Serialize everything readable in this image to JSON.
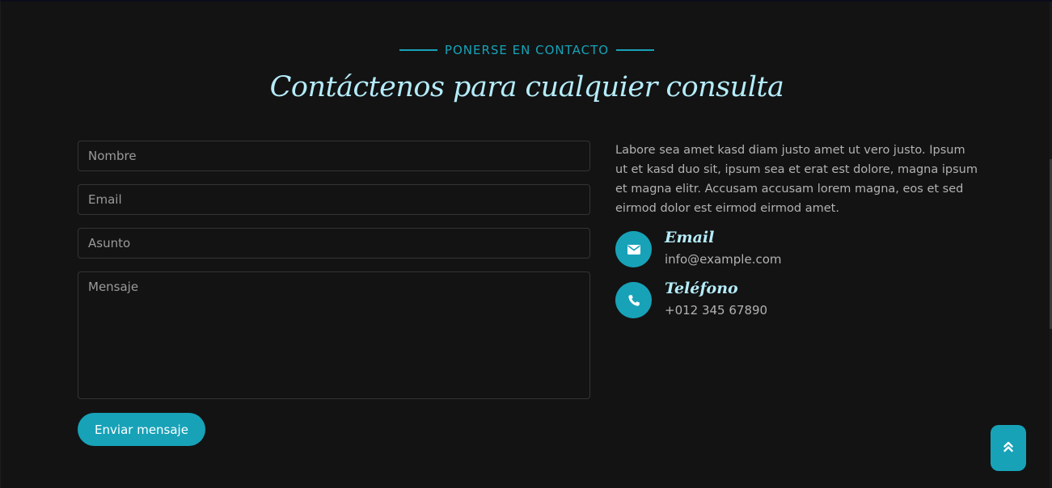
{
  "section": {
    "eyebrow": "PONERSE EN CONTACTO",
    "heading": "Contáctenos para cualquier consulta"
  },
  "form": {
    "name_placeholder": "Nombre",
    "email_placeholder": "Email",
    "subject_placeholder": "Asunto",
    "message_placeholder": "Mensaje",
    "submit_label": "Enviar mensaje"
  },
  "info": {
    "description": "Labore sea amet kasd diam justo amet ut vero justo. Ipsum ut et kasd duo sit, ipsum sea et erat est dolore, magna ipsum et magna elitr. Accusam accusam lorem magna, eos et sed eirmod dolor est eirmod eirmod amet.",
    "email": {
      "icon": "envelope-icon",
      "title": "Email",
      "value": "info@example.com"
    },
    "phone": {
      "icon": "phone-icon",
      "title": "Teléfono",
      "value": "+012 345 67890"
    }
  },
  "back_to_top": {
    "icon": "double-chevron-up-icon"
  },
  "colors": {
    "accent": "#17a2b8",
    "heading": "#b5ecfa",
    "background": "#131313",
    "body_text": "#b2b2b2"
  }
}
